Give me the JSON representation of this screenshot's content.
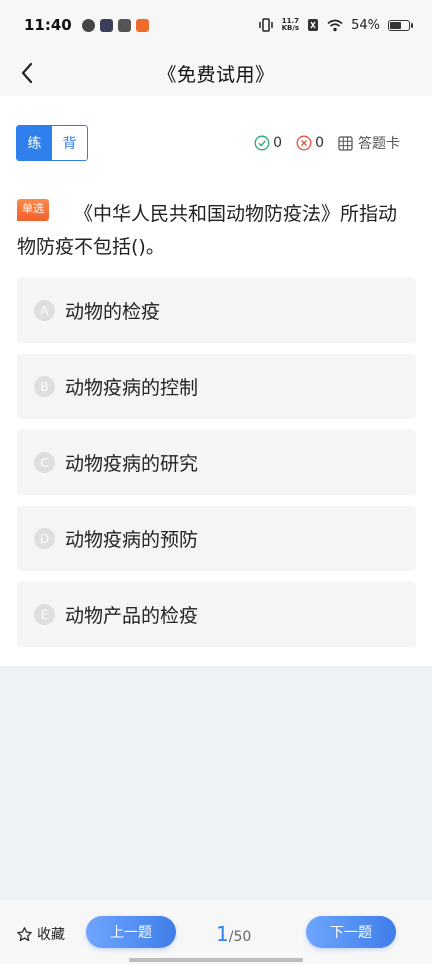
{
  "status_bar": {
    "time": "11:40",
    "net_speed_value": "11.7",
    "net_speed_unit": "KB/s",
    "battery": "54%",
    "battery_level": 0.54
  },
  "header": {
    "title": "《免费试用》"
  },
  "mode": {
    "practice": "练",
    "recite": "背"
  },
  "stats": {
    "correct": "0",
    "wrong": "0",
    "answer_card": "答题卡"
  },
  "question": {
    "type": "单选",
    "text": "《中华人民共和国动物防疫法》所指动物防疫不包括()。"
  },
  "options": [
    {
      "letter": "A",
      "text": "动物的检疫"
    },
    {
      "letter": "B",
      "text": "动物疫病的控制"
    },
    {
      "letter": "C",
      "text": "动物疫病的研究"
    },
    {
      "letter": "D",
      "text": "动物疫病的预防"
    },
    {
      "letter": "E",
      "text": "动物产品的检疫"
    }
  ],
  "bottom": {
    "favorite": "收藏",
    "prev": "上一题",
    "next": "下一题",
    "current": "1",
    "total": "/50"
  },
  "colors": {
    "accent": "#2f80ed",
    "badge": "#f2602a"
  }
}
